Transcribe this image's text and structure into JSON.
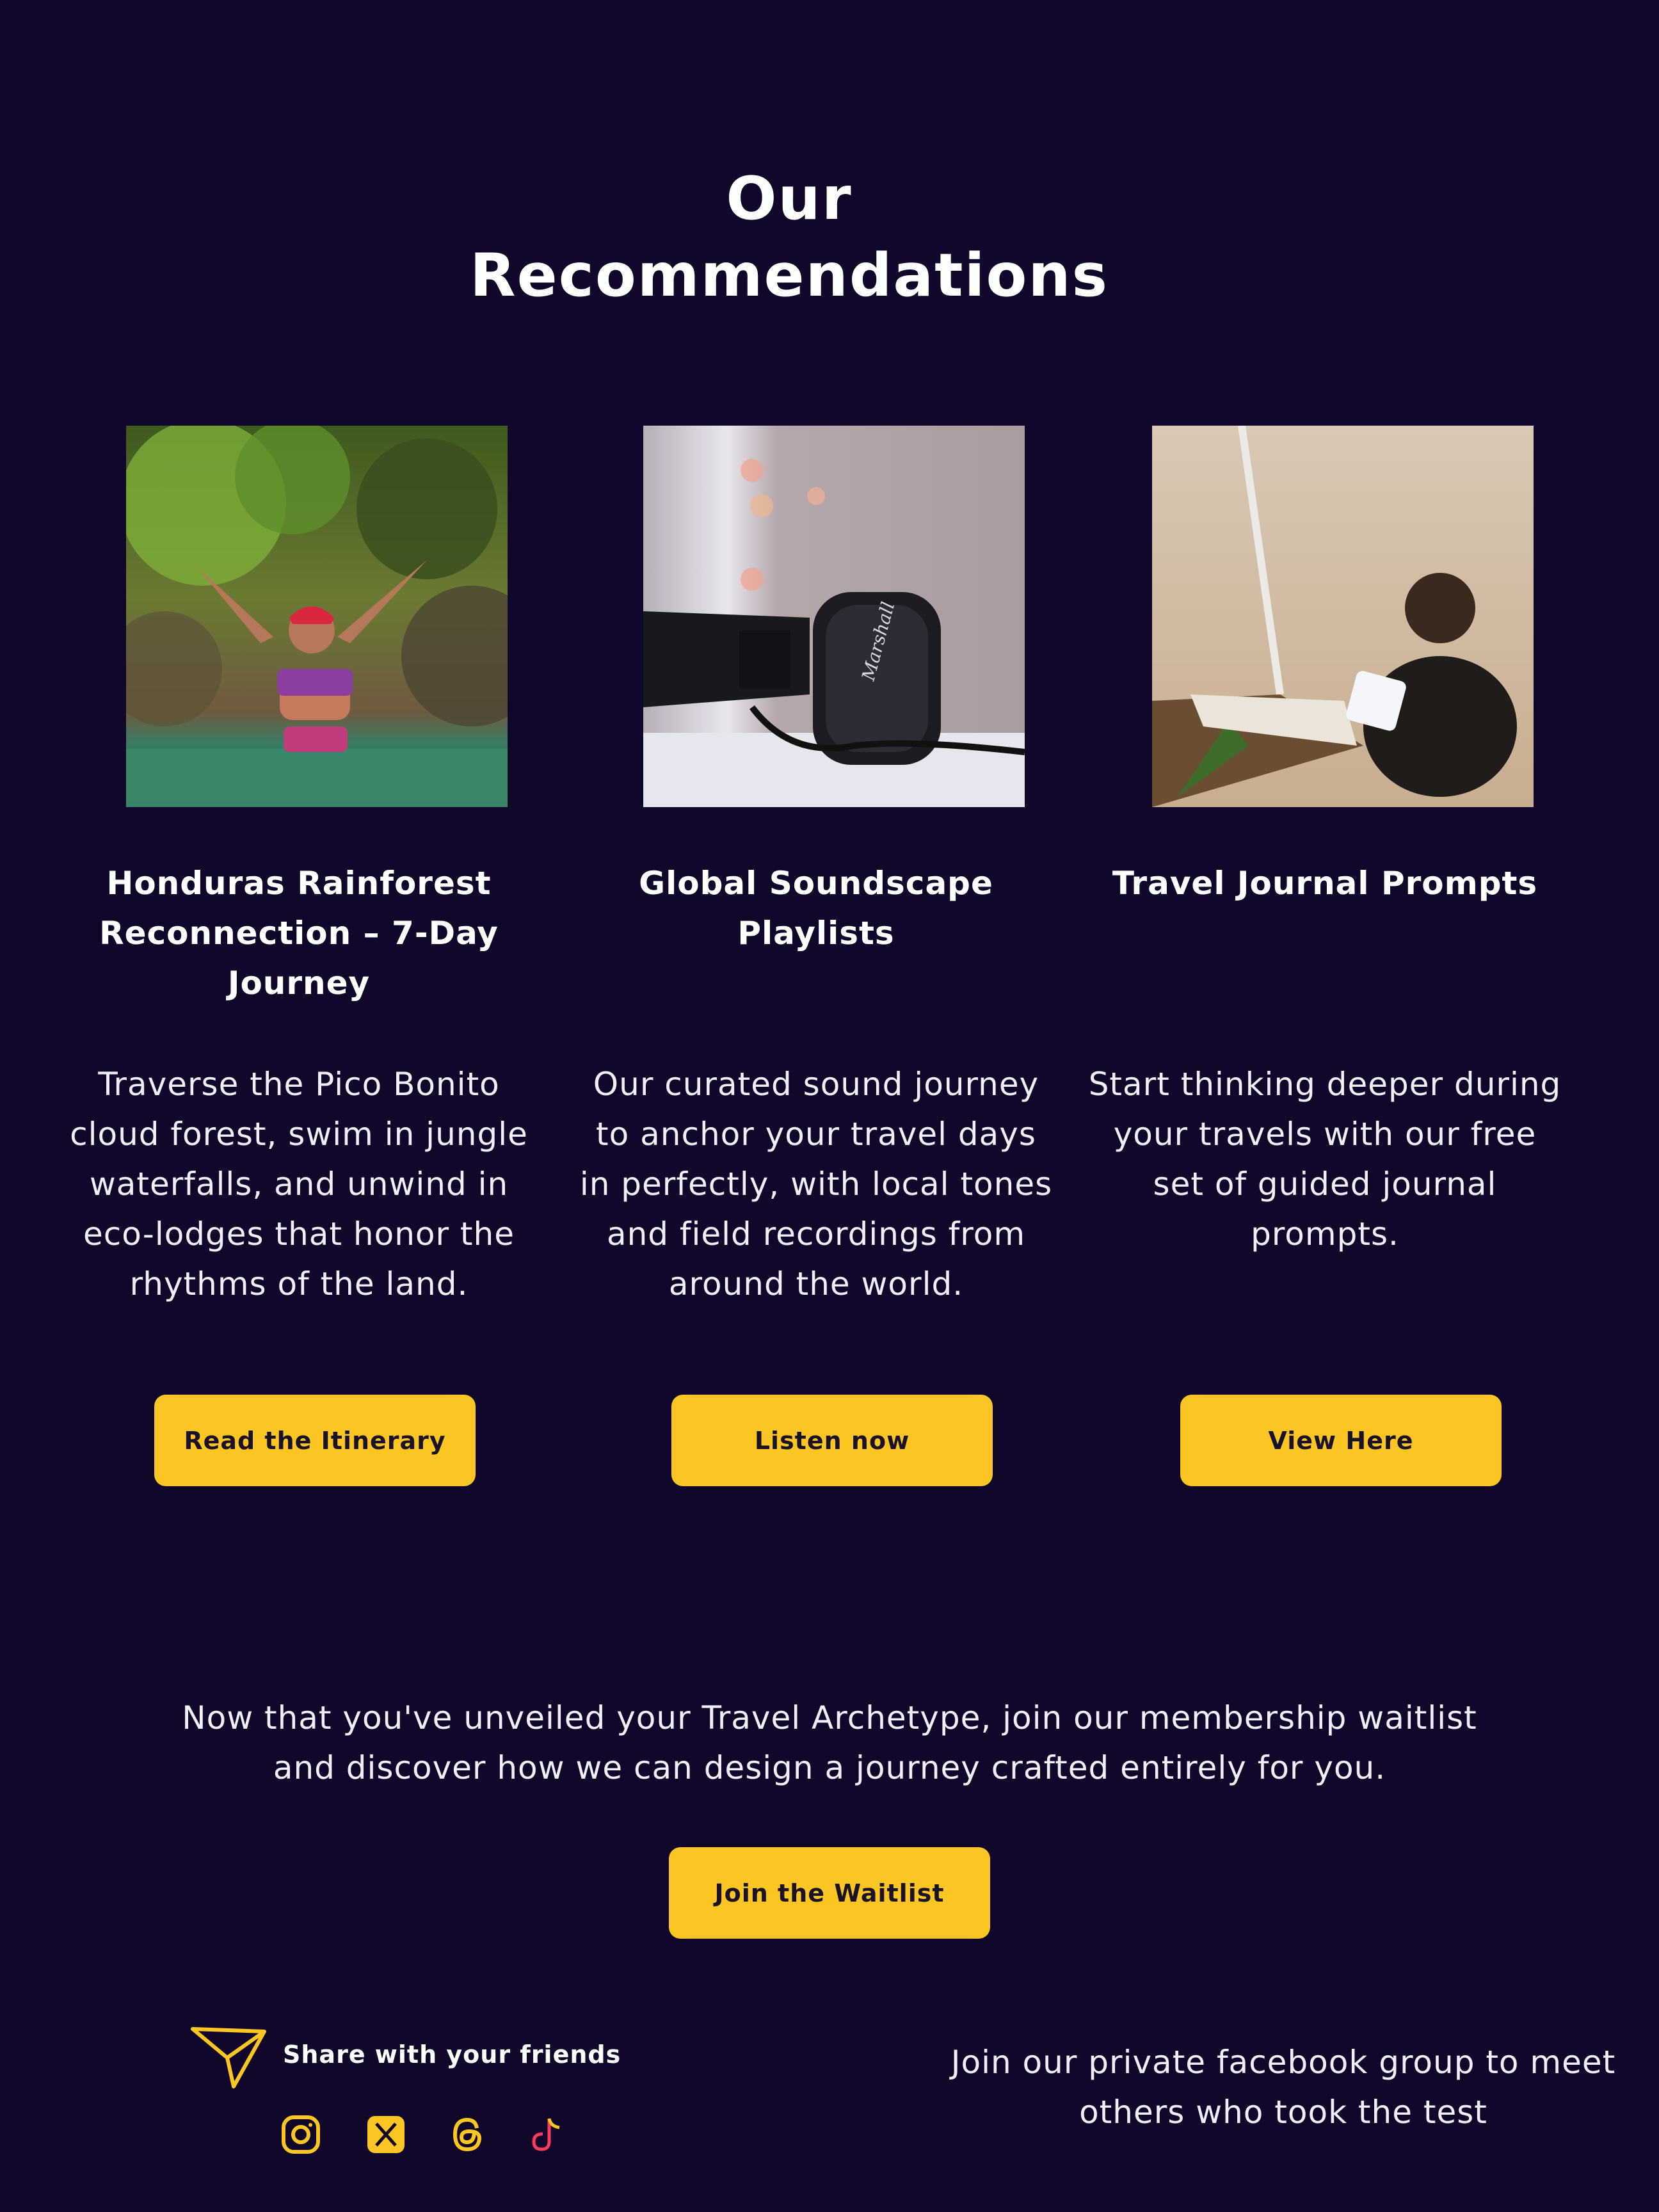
{
  "page": {
    "title": "Our Recommendations",
    "colors": {
      "background": "#10072b",
      "accent": "#fbc524",
      "text": "#ffffff"
    }
  },
  "recommendations": [
    {
      "image": "woman-in-rainforest-waterfall-photo",
      "title": "Honduras Rainforest Reconnection – 7-Day Journey",
      "description": "Traverse the Pico Bonito cloud forest, swim in jungle waterfalls, and unwind in eco-lodges that honor the rhythms of the land.",
      "button_label": "Read the Itinerary"
    },
    {
      "image": "headphones-photo",
      "title": "Global Soundscape Playlists",
      "description": "Our curated sound journey to anchor your travel days in perfectly, with local tones and field recordings from around the world.",
      "button_label": "Listen now"
    },
    {
      "image": "man-writing-journal-on-beach-photo",
      "title": "Travel Journal Prompts",
      "description": "Start thinking deeper during your travels with our free set of guided journal prompts.",
      "button_label": "View Here"
    }
  ],
  "waitlist": {
    "text": "Now that you've unveiled your Travel Archetype, join our membership waitlist and discover how we can design a journey crafted entirely for you.",
    "button_label": "Join the Waitlist"
  },
  "share": {
    "label": "Share with your friends",
    "icon": "send-icon",
    "socials": [
      "instagram-icon",
      "x-icon",
      "threads-icon",
      "tiktok-icon"
    ]
  },
  "facebook": {
    "text": "Join our private facebook group to meet others who took the test"
  }
}
